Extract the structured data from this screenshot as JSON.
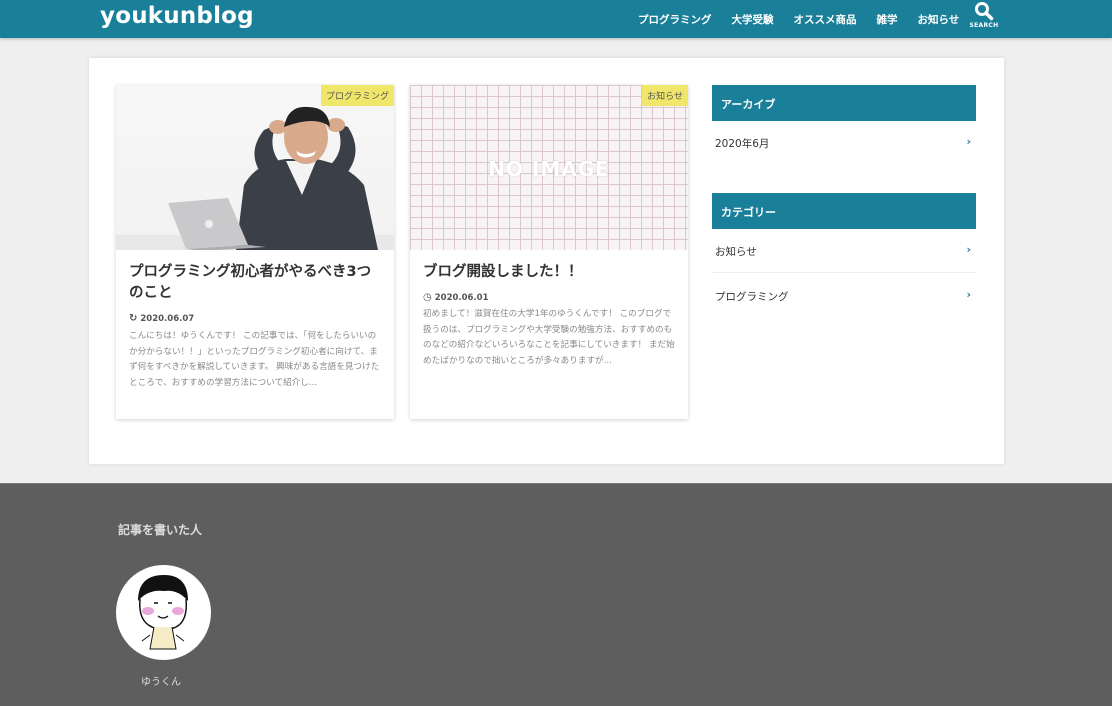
{
  "header": {
    "logo": "youkunblog",
    "nav": [
      "プログラミング",
      "大学受験",
      "オススメ商品",
      "雑学",
      "お知らせ"
    ],
    "search_label": "SEARCH",
    "color": "#1a7f98"
  },
  "posts": [
    {
      "category": "プログラミング",
      "title": "プログラミング初心者がやるべき3つのこと",
      "date": "2020.06.07",
      "date_icon": "update-icon",
      "excerpt": "こんにちは！ゆうくんです！ この記事では、「何をしたらいいのか分からない！！」といったプログラミング初心者に向けて、まず何をすべきかを解説していきます。 興味がある言語を見つけたところで、おすすめの学習方法について紹介し..."
    },
    {
      "category": "お知らせ",
      "title": "ブログ開設しました！！",
      "thumbnail_text": "NO IMAGE",
      "date": "2020.06.01",
      "date_icon": "clock-icon",
      "excerpt": "初めまして！滋賀在住の大学1年のゆうくんです！ このブログで扱うのは、プログラミングや大学受験の勉強方法、おすすめのものなどの紹介などいろいろなことを記事にしていきます！ まだ始めたばかりなので拙いところが多々ありますが..."
    }
  ],
  "sidebar": {
    "archive_title": "アーカイブ",
    "archive_items": [
      "2020年6月"
    ],
    "category_title": "カテゴリー",
    "category_items": [
      "お知らせ",
      "プログラミング"
    ]
  },
  "footer": {
    "title": "記事を書いた人",
    "author": "ゆうくん"
  },
  "colors": {
    "accent": "#1a7f98",
    "badge": "#f0e66a",
    "footer_bg": "#5e5e5e"
  }
}
